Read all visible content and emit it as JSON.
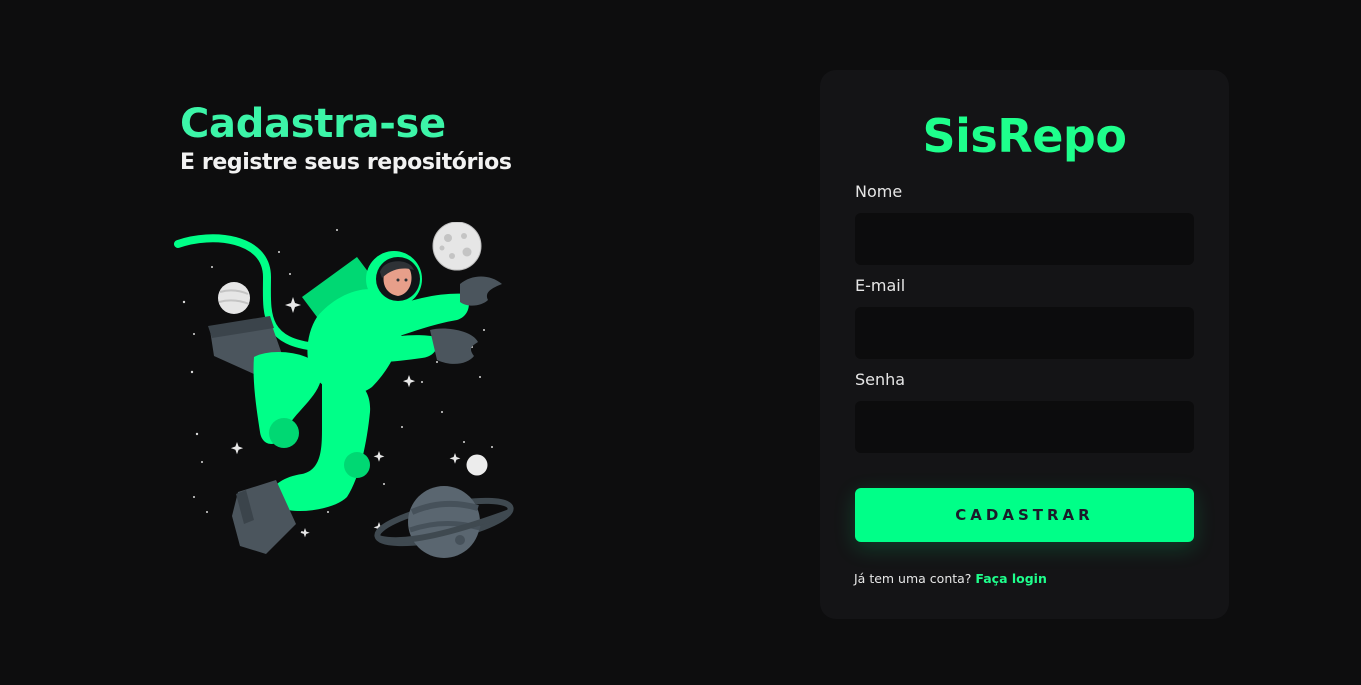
{
  "hero": {
    "title": "Cadastra-se",
    "subtitle": "E registre seus repositórios",
    "illustration": "astronaut-floating-in-space"
  },
  "card": {
    "brand": "SisRepo",
    "fields": [
      {
        "label": "Nome",
        "value": "",
        "placeholder": ""
      },
      {
        "label": "E-mail",
        "value": "",
        "placeholder": ""
      },
      {
        "label": "Senha",
        "value": "",
        "placeholder": ""
      }
    ],
    "submit_label": "CADASTRAR",
    "footer_text": "Já tem uma conta?",
    "login_link": "Faça login"
  },
  "colors": {
    "background": "#0d0d0e",
    "card": "#141416",
    "accent": "#00ff88",
    "hero_title": "#3cf5a8",
    "input_bg": "#0c0c0d"
  }
}
